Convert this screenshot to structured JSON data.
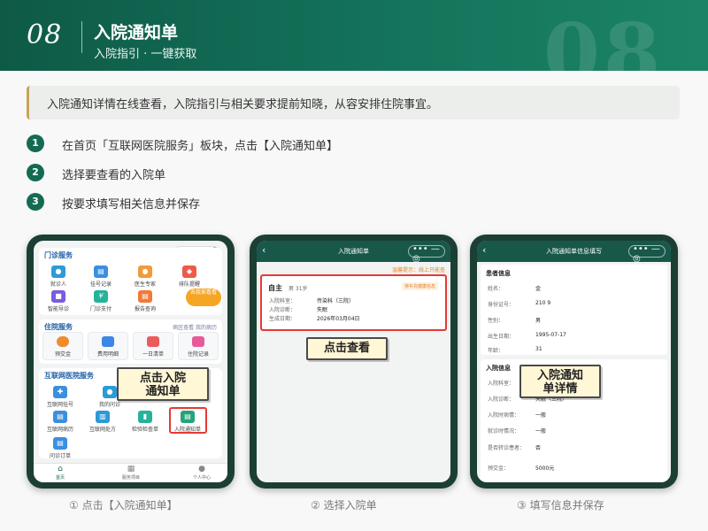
{
  "header": {
    "number": "08",
    "title": "入院通知单",
    "subtitle": "入院指引 · 一键获取",
    "watermark": "08"
  },
  "intro_text": "入院通知详情在线查看，入院指引与相关要求提前知晓，从容安排住院事宜。",
  "steps": [
    {
      "num": "1",
      "text": "在首页「互联网医院服务」板块，点击【入院通知单】"
    },
    {
      "num": "2",
      "text": "选择要查看的入院单"
    },
    {
      "num": "3",
      "text": "按要求填写相关信息并保存"
    }
  ],
  "captions": [
    "① 点击【入院通知单】",
    "② 选择入院单",
    "③ 填写信息并保存"
  ],
  "phone1": {
    "capsule": "•••  —  ◎",
    "sec1_title": "门诊服务",
    "sec1_items": [
      "就诊人",
      "挂号记录",
      "医生专家",
      "排队提醒",
      "智能导诊",
      "门诊支付",
      "报告查询"
    ],
    "float_badge": "去我家看看",
    "sec2_title": "住院服务",
    "sec2_links": "病区查看    我的病历",
    "sec2_items": [
      "预交金",
      "费用明细",
      "一日清单",
      "住院记录"
    ],
    "sec3_title": "互联网医院服务",
    "sec3_items": [
      "互联网挂号",
      "我的问诊",
      "互联网病历",
      "互联网处方",
      "检验检查单",
      "入院通知单",
      "问诊订单"
    ],
    "tabs": [
      "首页",
      "服务项目",
      "个人中心"
    ],
    "callout": "点击入院\n通知单"
  },
  "phone2": {
    "title": "入院通知单",
    "capsule": "•••  —  ◎",
    "notice": "温馨提示：线上只能查",
    "patient_name": "自主",
    "patient_meta": "男 31岁",
    "status_badge": "待补充健康信息",
    "rows": [
      {
        "k": "入院科室：",
        "v": "传染科（三院）"
      },
      {
        "k": "入院诊断：",
        "v": "失眠"
      },
      {
        "k": "生成日期：",
        "v": "2026年03月04日"
      }
    ],
    "callout": "点击查看"
  },
  "phone3": {
    "title": "入院通知单信息填写",
    "capsule": "•••  —  ◎",
    "sec1_title": "患者信息",
    "patient_rows": [
      {
        "k": "姓名：",
        "v": "金"
      },
      {
        "k": "身份证号：",
        "v": "210                9"
      },
      {
        "k": "性别：",
        "v": "男"
      },
      {
        "k": "出生日期：",
        "v": "1995-07-17"
      },
      {
        "k": "年龄：",
        "v": "31"
      }
    ],
    "sec2_title": "入院信息",
    "admit_rows": [
      {
        "k": "入院科室：",
        "v": ""
      },
      {
        "k": "入院诊断：",
        "v": "失眠（三院）"
      },
      {
        "k": "入院时病情：",
        "v": "一般"
      },
      {
        "k": "就诊时情况：",
        "v": "一般"
      },
      {
        "k": "是否转诊患者：",
        "v": "否"
      },
      {
        "k": "预交金：",
        "v": "5000元"
      }
    ],
    "callout": "入院通知\n单详情"
  },
  "colors": {
    "banner": "#14735b",
    "accent": "#146a52",
    "gold": "#c7a45a",
    "highlight": "#e53935"
  }
}
